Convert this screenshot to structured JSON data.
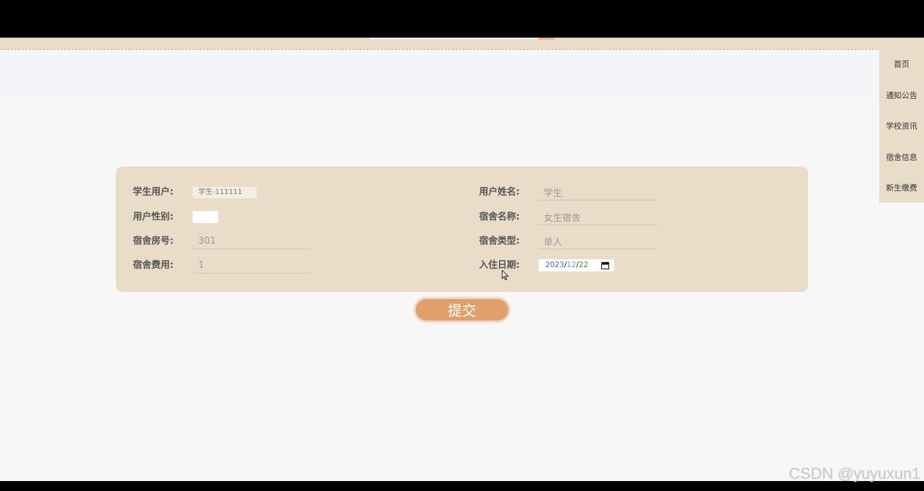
{
  "nav": {
    "items": [
      {
        "label": "首页"
      },
      {
        "label": "通知公告"
      },
      {
        "label": "学校资讯"
      },
      {
        "label": "宿舍信息"
      },
      {
        "label": "新生缴费"
      }
    ]
  },
  "form": {
    "student_user": {
      "label": "学生用户:",
      "value": "学生-111111"
    },
    "gender": {
      "label": "用户性别:"
    },
    "room_no": {
      "label": "宿舍房号:",
      "value": "301"
    },
    "fee": {
      "label": "宿舍费用:",
      "value": "1"
    },
    "user_name": {
      "label": "用户姓名:",
      "value": "学生"
    },
    "dorm_name": {
      "label": "宿舍名称:",
      "value": "女生宿舍"
    },
    "dorm_type": {
      "label": "宿舍类型:",
      "value": "单人"
    },
    "checkin_date": {
      "label": "入住日期:",
      "year": "2023",
      "month": "12",
      "day": "22",
      "separator": "/",
      "icon": "calendar-icon"
    }
  },
  "submit": {
    "label": "提交"
  },
  "watermark": {
    "text": "CSDN @yuyuxun1"
  },
  "icons": {
    "cursor": "mouse-cursor-icon"
  },
  "colors": {
    "page_background": "#f7f7f7",
    "panel": "#e9dcc9",
    "button": "#dfa06b",
    "accent": "#f0b58a",
    "label_text": "#555555",
    "value_text": "#9a9a9a"
  }
}
